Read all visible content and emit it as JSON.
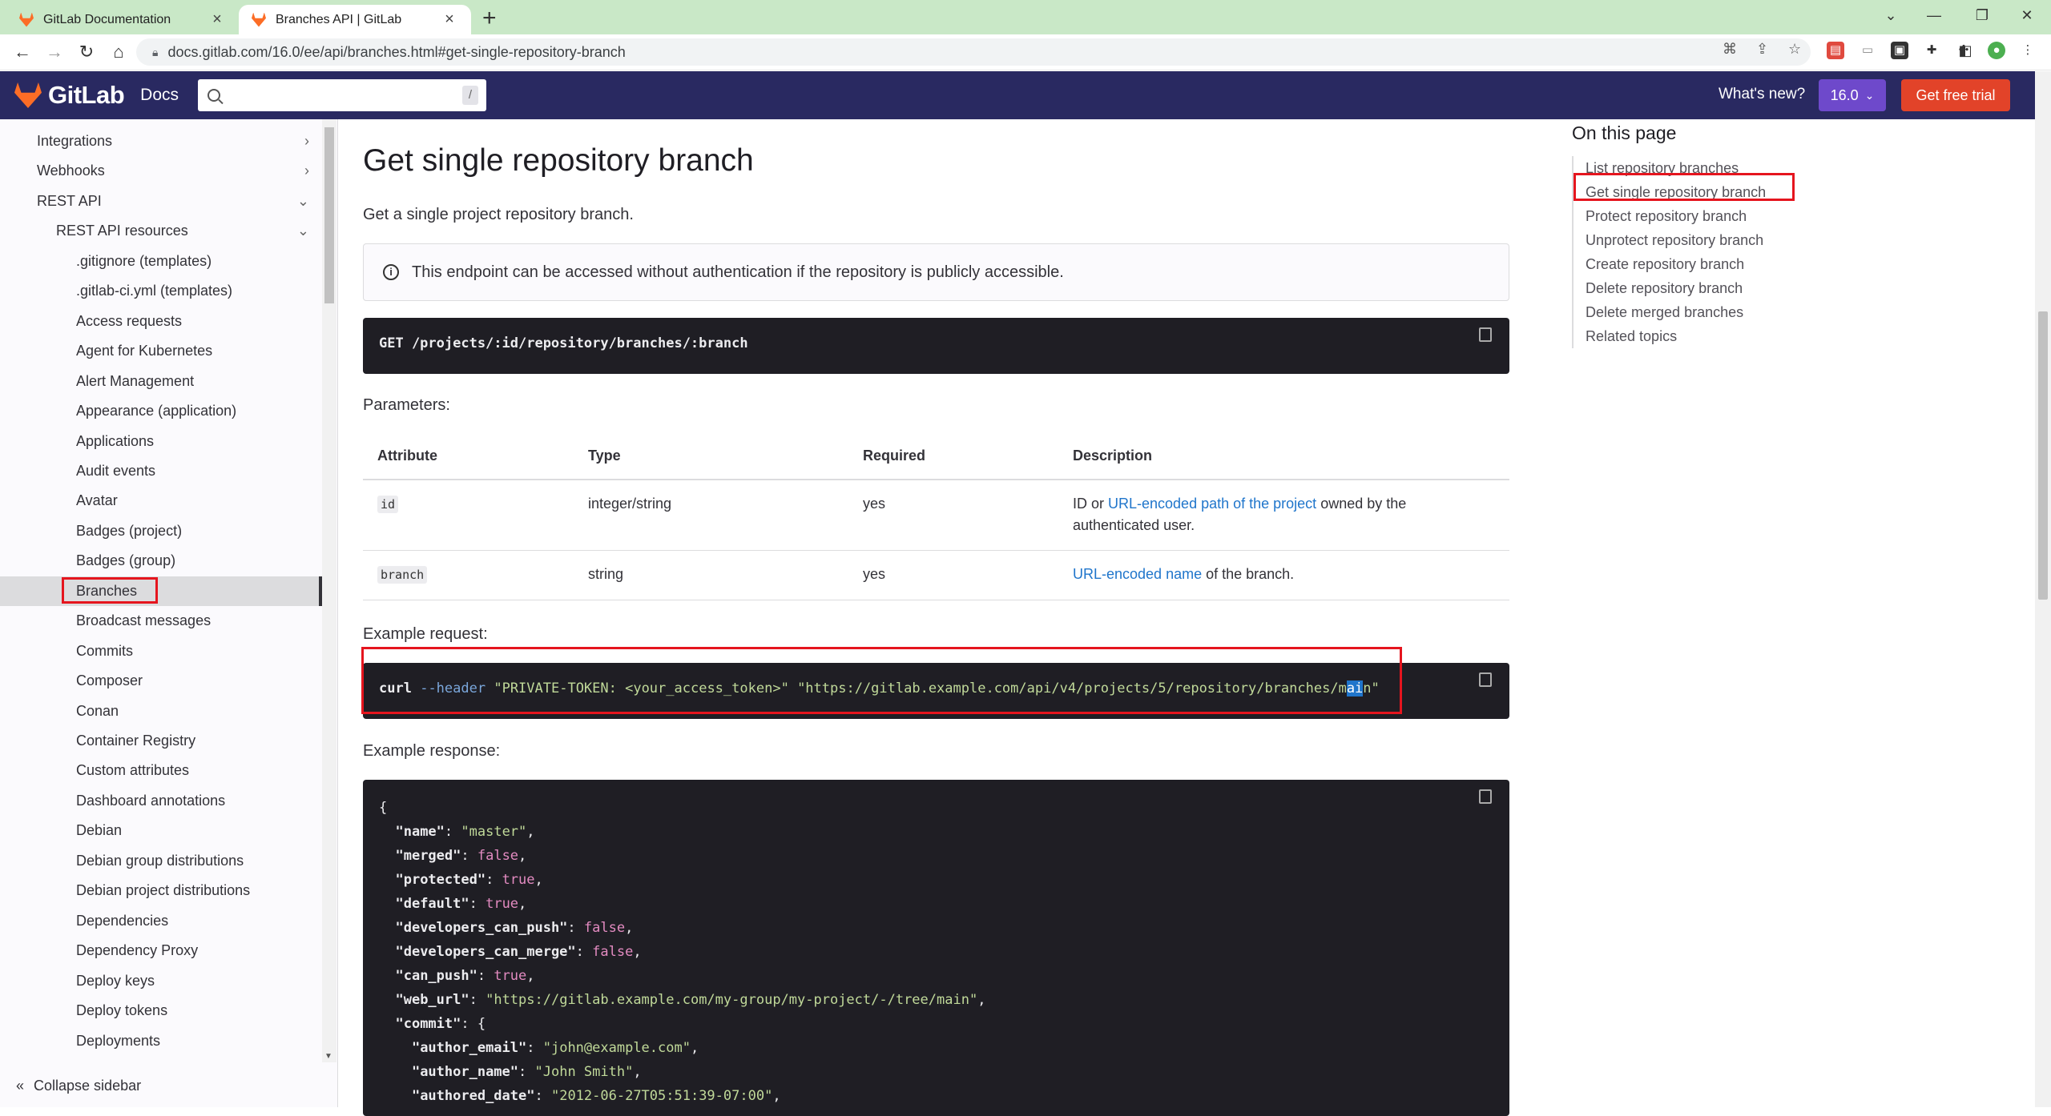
{
  "browser": {
    "tabs": [
      {
        "title": "GitLab Documentation",
        "active": false
      },
      {
        "title": "Branches API | GitLab",
        "active": true
      }
    ],
    "url": "docs.gitlab.com/16.0/ee/api/branches.html#get-single-repository-branch"
  },
  "header": {
    "brand": "GitLab",
    "docs": "Docs",
    "search_placeholder": "",
    "search_shortcut": "/",
    "whats_new": "What's new?",
    "version": "16.0",
    "trial": "Get free trial"
  },
  "sidebar": {
    "items": [
      {
        "label": "Integrations",
        "level": 0,
        "chevron": "›"
      },
      {
        "label": "Webhooks",
        "level": 0,
        "chevron": "›"
      },
      {
        "label": "REST API",
        "level": 0,
        "chevron": "⌄"
      },
      {
        "label": "REST API resources",
        "level": 1,
        "chevron": "⌄"
      },
      {
        "label": ".gitignore (templates)",
        "level": 2
      },
      {
        "label": ".gitlab-ci.yml (templates)",
        "level": 2
      },
      {
        "label": "Access requests",
        "level": 2
      },
      {
        "label": "Agent for Kubernetes",
        "level": 2
      },
      {
        "label": "Alert Management",
        "level": 2
      },
      {
        "label": "Appearance (application)",
        "level": 2
      },
      {
        "label": "Applications",
        "level": 2
      },
      {
        "label": "Audit events",
        "level": 2
      },
      {
        "label": "Avatar",
        "level": 2
      },
      {
        "label": "Badges (project)",
        "level": 2
      },
      {
        "label": "Badges (group)",
        "level": 2
      },
      {
        "label": "Branches",
        "level": 2,
        "active": true
      },
      {
        "label": "Broadcast messages",
        "level": 2
      },
      {
        "label": "Commits",
        "level": 2
      },
      {
        "label": "Composer",
        "level": 2
      },
      {
        "label": "Conan",
        "level": 2
      },
      {
        "label": "Container Registry",
        "level": 2
      },
      {
        "label": "Custom attributes",
        "level": 2
      },
      {
        "label": "Dashboard annotations",
        "level": 2
      },
      {
        "label": "Debian",
        "level": 2
      },
      {
        "label": "Debian group distributions",
        "level": 2
      },
      {
        "label": "Debian project distributions",
        "level": 2
      },
      {
        "label": "Dependencies",
        "level": 2
      },
      {
        "label": "Dependency Proxy",
        "level": 2
      },
      {
        "label": "Deploy keys",
        "level": 2
      },
      {
        "label": "Deploy tokens",
        "level": 2
      },
      {
        "label": "Deployments",
        "level": 2
      }
    ],
    "collapse": "Collapse sidebar"
  },
  "main": {
    "title": "Get single repository branch",
    "intro": "Get a single project repository branch.",
    "alert": "This endpoint can be accessed without authentication if the repository is publicly accessible.",
    "endpoint": "GET /projects/:id/repository/branches/:branch",
    "params_label": "Parameters:",
    "table": {
      "headers": [
        "Attribute",
        "Type",
        "Required",
        "Description"
      ],
      "rows": [
        {
          "attr": "id",
          "type": "integer/string",
          "required": "yes",
          "desc_pre": "ID or ",
          "desc_link": "URL-encoded path of the project",
          "desc_post": " owned by the authenticated user."
        },
        {
          "attr": "branch",
          "type": "string",
          "required": "yes",
          "desc_pre": "",
          "desc_link": "URL-encoded name",
          "desc_post": " of the branch."
        }
      ]
    },
    "example_request_label": "Example request:",
    "curl": {
      "cmd": "curl",
      "flag": "--header",
      "header_val": "\"PRIVATE-TOKEN: <your_access_token>\"",
      "url_pre": "\"https://gitlab.example.com/api/v4/projects/5/repository/branches/m",
      "url_sel": "ai",
      "url_post": "n\""
    },
    "example_response_label": "Example response:",
    "json_lines": [
      {
        "indent": "",
        "text": "{"
      },
      {
        "indent": "  ",
        "key": "\"name\"",
        "val": "\"master\"",
        "vtype": "s"
      },
      {
        "indent": "  ",
        "key": "\"merged\"",
        "val": "false",
        "vtype": "b"
      },
      {
        "indent": "  ",
        "key": "\"protected\"",
        "val": "true",
        "vtype": "b"
      },
      {
        "indent": "  ",
        "key": "\"default\"",
        "val": "true",
        "vtype": "b"
      },
      {
        "indent": "  ",
        "key": "\"developers_can_push\"",
        "val": "false",
        "vtype": "b"
      },
      {
        "indent": "  ",
        "key": "\"developers_can_merge\"",
        "val": "false",
        "vtype": "b"
      },
      {
        "indent": "  ",
        "key": "\"can_push\"",
        "val": "true",
        "vtype": "b"
      },
      {
        "indent": "  ",
        "key": "\"web_url\"",
        "val": "\"https://gitlab.example.com/my-group/my-project/-/tree/main\"",
        "vtype": "s"
      },
      {
        "indent": "  ",
        "key": "\"commit\"",
        "val": "{",
        "vtype": "p",
        "nocomma": true
      },
      {
        "indent": "    ",
        "key": "\"author_email\"",
        "val": "\"john@example.com\"",
        "vtype": "s"
      },
      {
        "indent": "    ",
        "key": "\"author_name\"",
        "val": "\"John Smith\"",
        "vtype": "s"
      },
      {
        "indent": "    ",
        "key": "\"authored_date\"",
        "val": "\"2012-06-27T05:51:39-07:00\"",
        "vtype": "s"
      }
    ]
  },
  "toc": {
    "title": "On this page",
    "items": [
      "List repository branches",
      "Get single repository branch",
      "Protect repository branch",
      "Unprotect repository branch",
      "Create repository branch",
      "Delete repository branch",
      "Delete merged branches",
      "Related topics"
    ]
  }
}
